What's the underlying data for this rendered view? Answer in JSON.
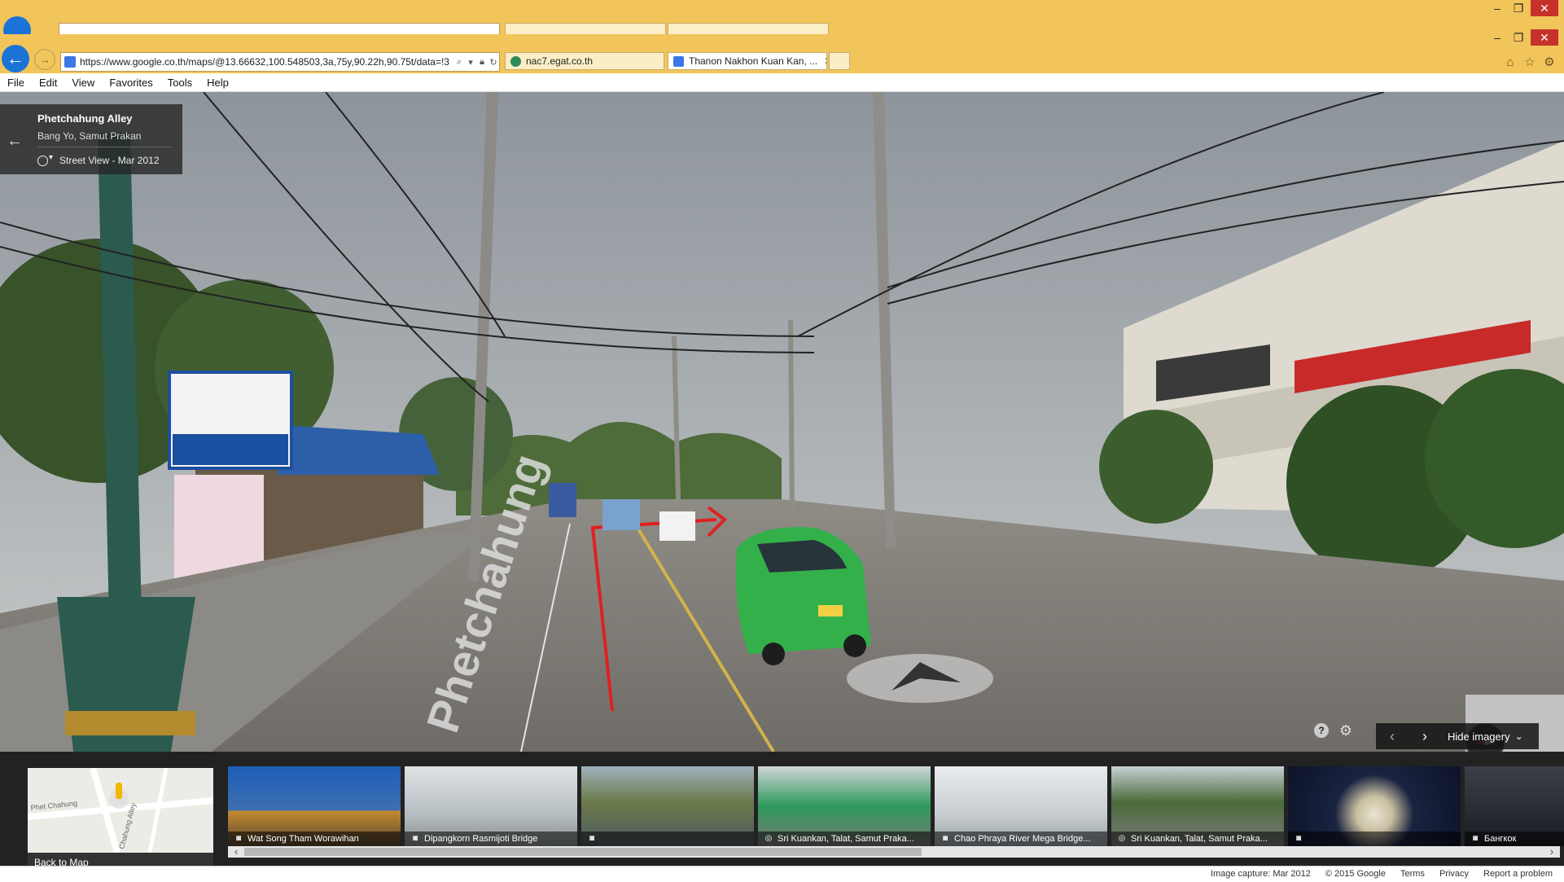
{
  "browser": {
    "url": "https://www.google.co.th/maps/@13.66632,100.548503,3a,75y,90.22h,90.75t/data=!3",
    "tabs": [
      {
        "label": "nac7.egat.co.th",
        "active": false
      },
      {
        "label": "Thanon Nakhon Kuan Kan, ...",
        "active": true
      }
    ],
    "menu": [
      "File",
      "Edit",
      "View",
      "Favorites",
      "Tools",
      "Help"
    ]
  },
  "street_view": {
    "title": "Phetchahung Alley",
    "subtitle": "Bang Yo, Samut Prakan",
    "capture_label": "Street View - Mar 2012",
    "hide_imagery_label": "Hide imagery",
    "road_label": "Phetchahung"
  },
  "thumbnails": [
    {
      "label": "Wat Song Tham Worawihan",
      "icon": "camera-icon"
    },
    {
      "label": "Dipangkorn Rasmijoti Bridge",
      "icon": "camera-icon"
    },
    {
      "label": "",
      "icon": "camera-icon"
    },
    {
      "label": "Sri Kuankan, Talat, Samut Praka...",
      "icon": "panorama-icon"
    },
    {
      "label": "Chao Phraya River Mega Bridge...",
      "icon": "camera-icon"
    },
    {
      "label": "Sri Kuankan, Talat, Samut Praka...",
      "icon": "panorama-icon"
    },
    {
      "label": "",
      "icon": "camera-icon"
    },
    {
      "label": "Бангкок",
      "icon": "camera-icon"
    }
  ],
  "minimap": {
    "back_label": "Back to Map",
    "street_a": "Phet Chahung",
    "street_b": "Chahung Alley"
  },
  "footer": {
    "image_capture": "Image capture: Mar 2012",
    "copyright": "© 2015 Google",
    "terms": "Terms",
    "privacy": "Privacy",
    "report": "Report a problem"
  },
  "colors": {
    "chrome": "#f2c55a",
    "accent": "#1b73d8",
    "close": "#c6312b"
  }
}
